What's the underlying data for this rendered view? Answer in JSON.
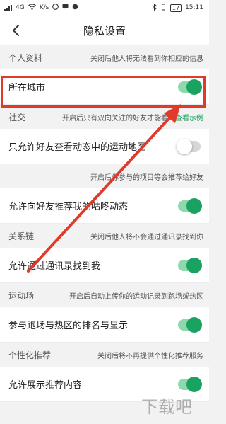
{
  "status_bar": {
    "network": "4G",
    "speed": "K/s",
    "battery": "17",
    "time": "15:11"
  },
  "nav": {
    "title": "隐私设置",
    "back_icon": "chevron-left-icon"
  },
  "sections": {
    "profile": {
      "header": "个人资料",
      "desc": "关闭后他人将无法看到你相应的信息"
    },
    "social": {
      "header": "社交",
      "desc": "开启后只有双向关注的好友才能看到",
      "link": "查看示例"
    },
    "sports_map_hint": {
      "desc": "开启后你参与的项目等会推荐给好友"
    },
    "relations": {
      "header": "关系链",
      "desc": "关闭后他人将不会通过通讯录找到你"
    },
    "venues": {
      "header": "运动场",
      "desc": "开启后自动上传你的运动记录到跑场或热区"
    },
    "personalization": {
      "header": "个性化推荐",
      "desc": "关闭后将不再提供个性化推荐服务"
    }
  },
  "rows": {
    "city": {
      "label": "所在城市",
      "on": true
    },
    "friends_map": {
      "label": "只允许好友查看动态中的运动地图",
      "on": false
    },
    "recommend": {
      "label": "允许向好友推荐我的咕咚动态",
      "on": true
    },
    "contacts": {
      "label": "允许通过通讯录找到我",
      "on": true
    },
    "ranking": {
      "label": "参与跑场与热区的排名与显示",
      "on": true
    },
    "show_recommend": {
      "label": "允许展示推荐内容",
      "on": true
    }
  },
  "annotation": {
    "color": "#e03a2a"
  },
  "watermark": "下载吧",
  "colors": {
    "accent": "#1aa260",
    "track_on": "#8ed9ab",
    "track_off": "#d6d6d6"
  }
}
